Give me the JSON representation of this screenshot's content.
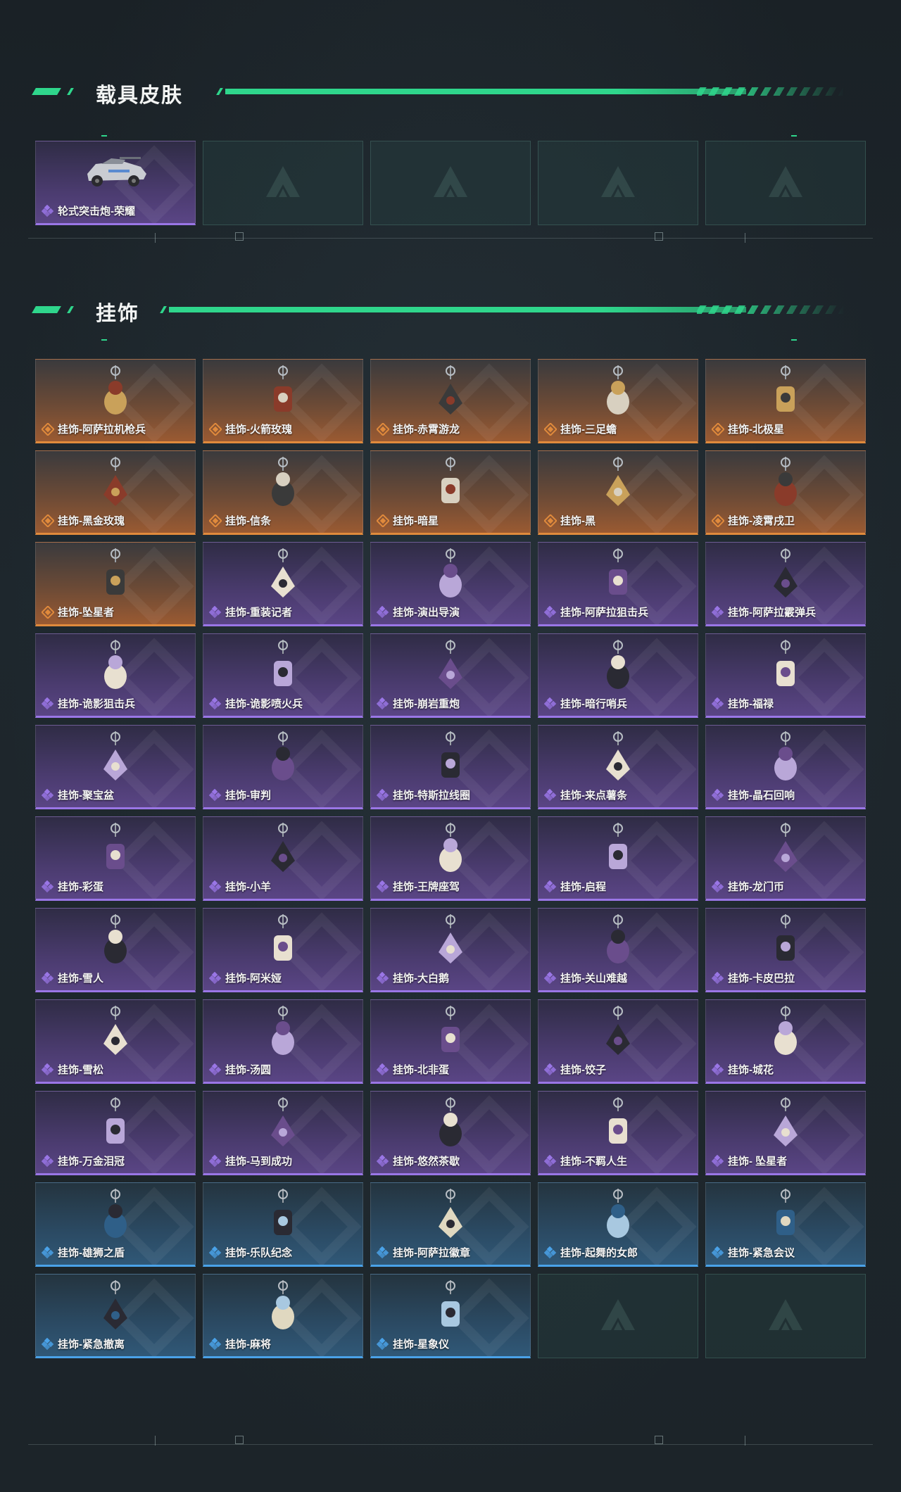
{
  "colors": {
    "accent": "#2fd68c",
    "orange": "#e08a3c",
    "purple": "#9a76e6",
    "blue": "#4aa2e8"
  },
  "sections": {
    "vehicle": {
      "title": "载具皮肤"
    },
    "charms": {
      "title": "挂饰"
    }
  },
  "vehicle_items": [
    {
      "label": "轮式突击炮-荣耀",
      "rarity": "purple",
      "icon": "armored-car-icon"
    },
    {
      "label": "",
      "rarity": "empty"
    },
    {
      "label": "",
      "rarity": "empty"
    },
    {
      "label": "",
      "rarity": "empty"
    },
    {
      "label": "",
      "rarity": "empty"
    }
  ],
  "charm_items": [
    {
      "label": "挂饰-阿萨拉机枪兵",
      "rarity": "orange"
    },
    {
      "label": "挂饰-火箭玫瑰",
      "rarity": "orange"
    },
    {
      "label": "挂饰-赤霄游龙",
      "rarity": "orange"
    },
    {
      "label": "挂饰-三足蟾",
      "rarity": "orange"
    },
    {
      "label": "挂饰-北极星",
      "rarity": "orange"
    },
    {
      "label": "挂饰-黑金玫瑰",
      "rarity": "orange"
    },
    {
      "label": "挂饰-信条",
      "rarity": "orange"
    },
    {
      "label": "挂饰-暗星",
      "rarity": "orange"
    },
    {
      "label": "挂饰-黑",
      "rarity": "orange"
    },
    {
      "label": "挂饰-凌霄戌卫",
      "rarity": "orange"
    },
    {
      "label": "挂饰-坠星者",
      "rarity": "orange"
    },
    {
      "label": "挂饰-重装记者",
      "rarity": "purple"
    },
    {
      "label": "挂饰-演出导演",
      "rarity": "purple"
    },
    {
      "label": "挂饰-阿萨拉狙击兵",
      "rarity": "purple"
    },
    {
      "label": "挂饰-阿萨拉霰弹兵",
      "rarity": "purple"
    },
    {
      "label": "挂饰-诡影狙击兵",
      "rarity": "purple"
    },
    {
      "label": "挂饰-诡影喷火兵",
      "rarity": "purple"
    },
    {
      "label": "挂饰-崩岩重炮",
      "rarity": "purple"
    },
    {
      "label": "挂饰-暗行哨兵",
      "rarity": "purple"
    },
    {
      "label": "挂饰-福禄",
      "rarity": "purple"
    },
    {
      "label": "挂饰-聚宝盆",
      "rarity": "purple"
    },
    {
      "label": "挂饰-审判",
      "rarity": "purple"
    },
    {
      "label": "挂饰-特斯拉线圈",
      "rarity": "purple"
    },
    {
      "label": "挂饰-来点薯条",
      "rarity": "purple"
    },
    {
      "label": "挂饰-晶石回响",
      "rarity": "purple"
    },
    {
      "label": "挂饰-彩蛋",
      "rarity": "purple"
    },
    {
      "label": "挂饰-小羊",
      "rarity": "purple"
    },
    {
      "label": "挂饰-王牌座驾",
      "rarity": "purple"
    },
    {
      "label": "挂饰-启程",
      "rarity": "purple"
    },
    {
      "label": "挂饰-龙门币",
      "rarity": "purple"
    },
    {
      "label": "挂饰-雪人",
      "rarity": "purple"
    },
    {
      "label": "挂饰-阿米娅",
      "rarity": "purple"
    },
    {
      "label": "挂饰-大白鹅",
      "rarity": "purple"
    },
    {
      "label": "挂饰-关山难越",
      "rarity": "purple"
    },
    {
      "label": "挂饰-卡皮巴拉",
      "rarity": "purple"
    },
    {
      "label": "挂饰-雪松",
      "rarity": "purple"
    },
    {
      "label": "挂饰-汤圆",
      "rarity": "purple"
    },
    {
      "label": "挂饰-北非蛋",
      "rarity": "purple"
    },
    {
      "label": "挂饰-饺子",
      "rarity": "purple"
    },
    {
      "label": "挂饰-城花",
      "rarity": "purple"
    },
    {
      "label": "挂饰-万金泪冠",
      "rarity": "purple"
    },
    {
      "label": "挂饰-马到成功",
      "rarity": "purple"
    },
    {
      "label": "挂饰-悠然茶歇",
      "rarity": "purple"
    },
    {
      "label": "挂饰-不羁人生",
      "rarity": "purple"
    },
    {
      "label": "挂饰- 坠星者",
      "rarity": "purple"
    },
    {
      "label": "挂饰-雄狮之盾",
      "rarity": "blue"
    },
    {
      "label": "挂饰-乐队纪念",
      "rarity": "blue"
    },
    {
      "label": "挂饰-阿萨拉徽章",
      "rarity": "blue"
    },
    {
      "label": "挂饰-起舞的女郎",
      "rarity": "blue"
    },
    {
      "label": "挂饰-紧急会议",
      "rarity": "blue"
    },
    {
      "label": "挂饰-紧急撤离",
      "rarity": "blue"
    },
    {
      "label": "挂饰-麻将",
      "rarity": "blue"
    },
    {
      "label": "挂饰-星象仪",
      "rarity": "blue"
    },
    {
      "label": "",
      "rarity": "empty"
    },
    {
      "label": "",
      "rarity": "empty"
    }
  ]
}
